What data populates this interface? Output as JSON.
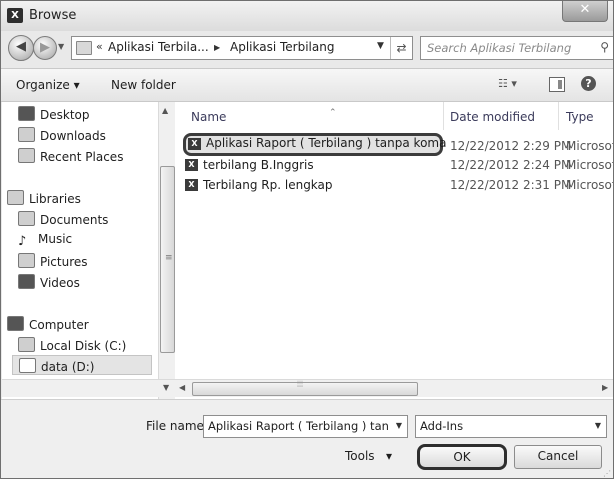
{
  "window": {
    "title": "Browse",
    "app_icon_text": "X"
  },
  "address": {
    "breadcrumbs": [
      "Aplikasi Terbila...",
      "Aplikasi Terbilang"
    ],
    "overflow": "«",
    "search_placeholder": "Search Aplikasi Terbilang"
  },
  "toolbar": {
    "organize_label": "Organize ▾",
    "new_folder_label": "New folder"
  },
  "nav": {
    "items": [
      "Desktop",
      "Downloads",
      "Recent Places",
      "Libraries",
      "Documents",
      "Music",
      "Pictures",
      "Videos",
      "Computer",
      "Local Disk (C:)",
      "data (D:)"
    ],
    "selected": "data (D:)"
  },
  "files": {
    "columns": [
      "Name",
      "Date modified",
      "Type"
    ],
    "rows": [
      {
        "name": "Aplikasi Raport ( Terbilang ) tanpa koma",
        "date": "12/22/2012 2:29 PM",
        "type": "Microsof",
        "selected": true
      },
      {
        "name": "terbilang B.Inggris",
        "date": "12/22/2012 2:24 PM",
        "type": "Microsof",
        "selected": false
      },
      {
        "name": "Terbilang Rp. lengkap",
        "date": "12/22/2012 2:31 PM",
        "type": "Microsof",
        "selected": false
      }
    ]
  },
  "footer": {
    "filename_label": "File name:",
    "filename_value": "Aplikasi Raport ( Terbilang ) tanpa",
    "filter_value": "Add-Ins",
    "tools_label": "Tools",
    "ok_label": "OK",
    "cancel_label": "Cancel"
  },
  "colors": {
    "selection_border": "#3c3c3c",
    "window_bg": "#e9e9e9"
  }
}
